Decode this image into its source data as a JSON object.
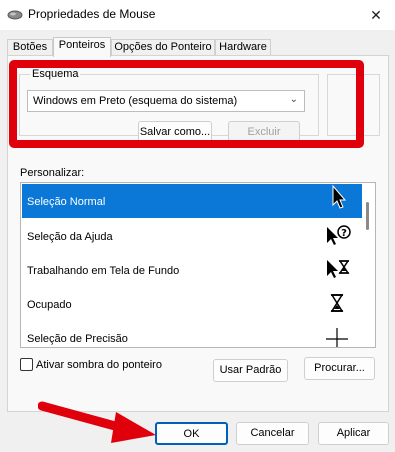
{
  "window": {
    "title": "Propriedades de Mouse",
    "close": "✕"
  },
  "tabs": [
    {
      "label": "Botões"
    },
    {
      "label": "Ponteiros",
      "active": true
    },
    {
      "label": "Opções do Ponteiro"
    },
    {
      "label": "Hardware"
    }
  ],
  "scheme": {
    "group_label": "Esquema",
    "selected": "Windows em Preto (esquema do sistema)",
    "save_as_label": "Salvar como...",
    "delete_label": "Excluir"
  },
  "customize": {
    "label": "Personalizar:",
    "items": [
      {
        "label": "Seleção Normal",
        "icon": "arrow-pointer-icon",
        "selected": true
      },
      {
        "label": "Seleção da Ajuda",
        "icon": "help-select-icon"
      },
      {
        "label": "Trabalhando em Tela de Fundo",
        "icon": "working-in-background-icon"
      },
      {
        "label": "Ocupado",
        "icon": "hourglass-icon"
      },
      {
        "label": "Seleção de Precisão",
        "icon": "crosshair-icon"
      }
    ]
  },
  "shadow": {
    "label": "Ativar sombra do ponteiro",
    "checked": false
  },
  "buttons": {
    "use_default": "Usar Padrão",
    "browse": "Procurar...",
    "ok": "OK",
    "cancel": "Cancelar",
    "apply": "Aplicar"
  },
  "colors": {
    "highlight": "#e0000c",
    "selection": "#0b78d7",
    "accent": "#005fb8"
  }
}
